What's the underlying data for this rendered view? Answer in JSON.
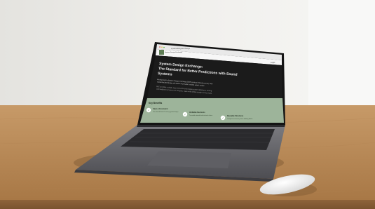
{
  "browser": {
    "url": "systemdesignexchange"
  },
  "site": {
    "logo_text": "System Design Exchange",
    "nav_link": "Login",
    "hero": {
      "title_line1": "System Design Exchange:",
      "title_line2": "The Standard for Better Predictions with Sound",
      "title_line3": "Systems",
      "intro_line1": "Introducing the System Design Exchange (SDE) protocol. Structure every new",
      "intro_line2": "model-backed design with better information, enable expert review.",
      "body_line1": "SDE provides a single, open format for exchanging system definitions, scoring",
      "body_line2": "and feedback so teams can compare, reuse and validate designs across tools."
    },
    "benefits": {
      "heading": "Key Benefits",
      "cards": [
        {
          "title": "Clear & Consistent",
          "desc": "One shared format for every system design"
        },
        {
          "title": "Verifiable Decisions",
          "desc": "Traceable rationale behind each choice"
        },
        {
          "title": "Reusable Structures",
          "desc": "Compose and reuse proven building blocks"
        }
      ]
    }
  },
  "colors": {
    "wall": "#efefed",
    "desk": "#b98a58",
    "laptop_body": "#6a6a6e",
    "screen_dark": "#1c1c1c",
    "benefits_green": "#9db49a",
    "mouse": "#f0f0f0"
  }
}
